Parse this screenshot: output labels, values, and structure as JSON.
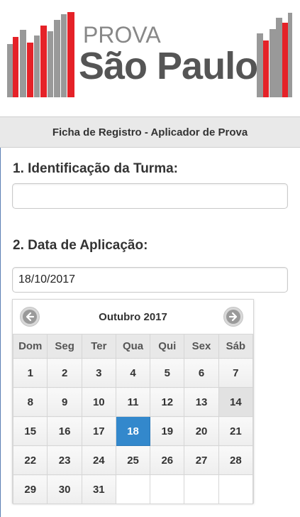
{
  "logo": {
    "line1": "PROVA",
    "line2": "São Paulo"
  },
  "header": {
    "title": "Ficha de Registro - Aplicador de Prova"
  },
  "form": {
    "field1_label": "1. Identificação da Turma:",
    "field1_value": "",
    "field2_label": "2. Data de Aplicação:",
    "field2_value": "18/10/2017"
  },
  "datepicker": {
    "month_label": "Outubro 2017",
    "weekdays": [
      "Dom",
      "Seg",
      "Ter",
      "Qua",
      "Qui",
      "Sex",
      "Sáb"
    ],
    "weeks": [
      [
        "1",
        "2",
        "3",
        "4",
        "5",
        "6",
        "7"
      ],
      [
        "8",
        "9",
        "10",
        "11",
        "12",
        "13",
        "14"
      ],
      [
        "15",
        "16",
        "17",
        "18",
        "19",
        "20",
        "21"
      ],
      [
        "22",
        "23",
        "24",
        "25",
        "26",
        "27",
        "28"
      ],
      [
        "29",
        "30",
        "31",
        "",
        "",
        "",
        ""
      ]
    ],
    "selected_day": "18",
    "highlighted_day": "14",
    "selected_color": "#3388cc"
  },
  "colors": {
    "brand_red": "#e52228",
    "brand_gray": "#999999"
  }
}
